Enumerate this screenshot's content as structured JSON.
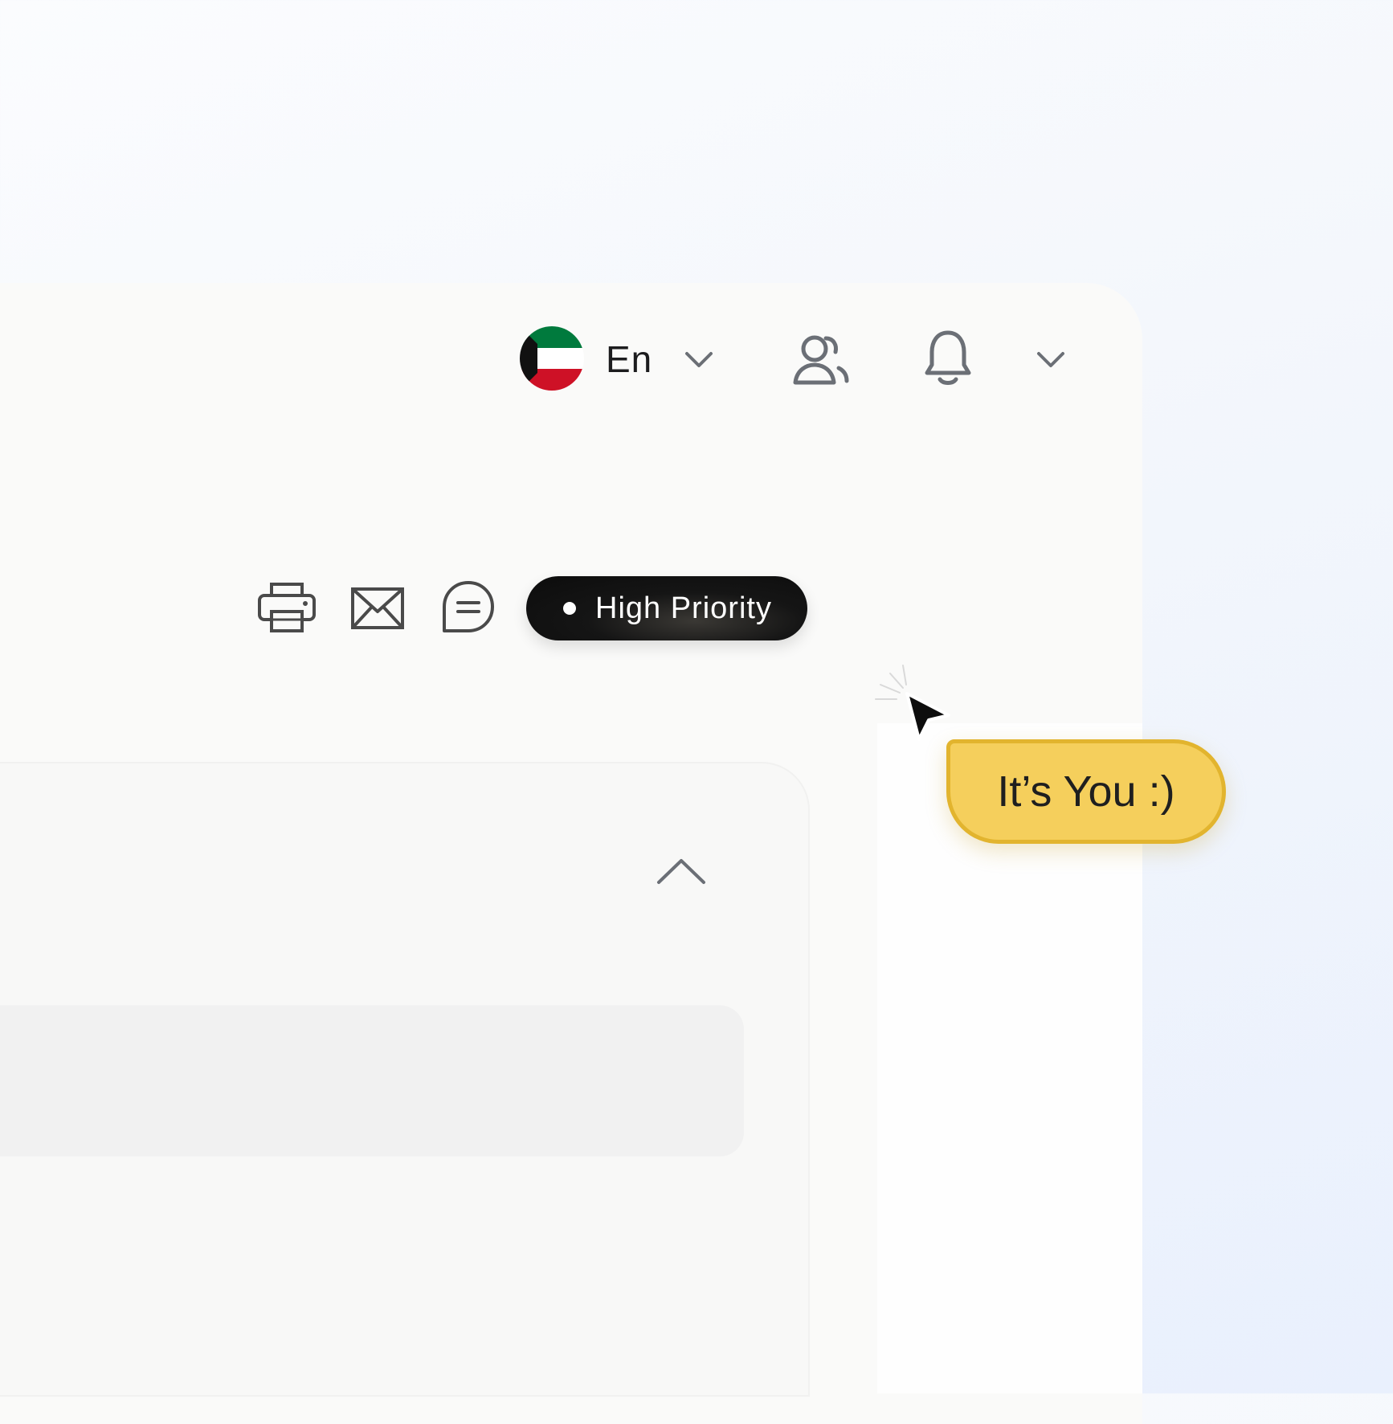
{
  "header": {
    "language_label": "En",
    "language_flag": "kuwait-flag",
    "icons": [
      "chevron-down-icon",
      "users-icon",
      "bell-icon",
      "chevron-down-icon"
    ]
  },
  "toolbar": {
    "icons": [
      "printer-icon",
      "mail-icon",
      "chat-icon"
    ],
    "priority_label": "High Priority"
  },
  "card": {
    "collapse_icon": "chevron-up-icon"
  },
  "cursor": {
    "bubble_label": "It’s You :)"
  },
  "colors": {
    "pill_bg": "#111111",
    "bubble_bg": "#f5cf5c",
    "bubble_border": "#e2b42e",
    "icon_stroke": "#6b6f76",
    "flag_green": "#007a3d",
    "flag_red": "#ce1126",
    "flag_black": "#111111"
  }
}
